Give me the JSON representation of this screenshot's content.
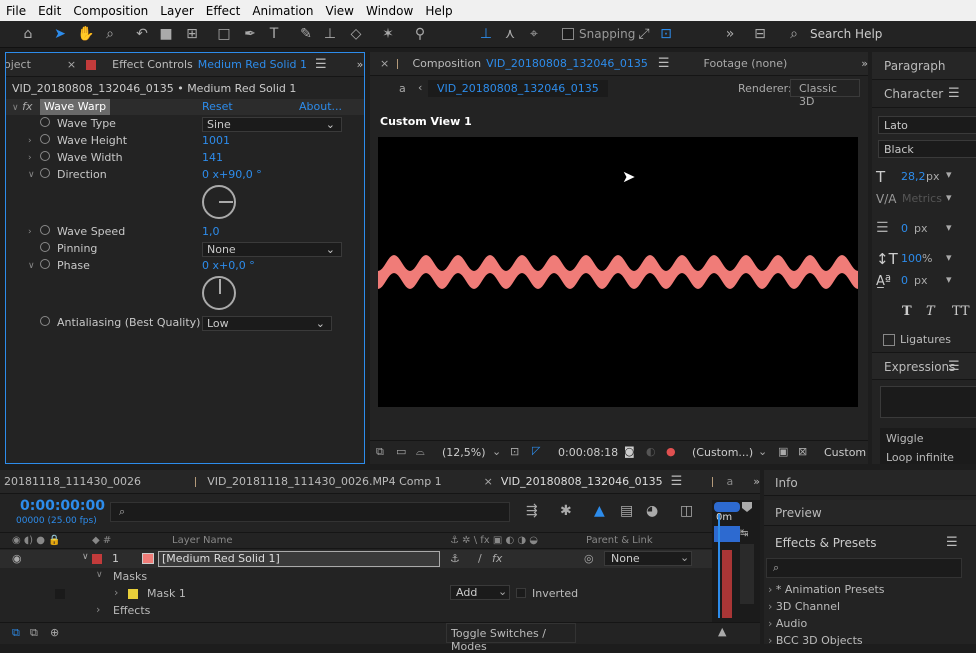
{
  "menu": [
    "File",
    "Edit",
    "Composition",
    "Layer",
    "Effect",
    "Animation",
    "View",
    "Window",
    "Help"
  ],
  "toolbar": {
    "snapping": "Snapping",
    "search": "Search Help"
  },
  "effect_panel": {
    "tab_project": "oject",
    "tab_prefix": "Effect Controls",
    "tab_name": "Medium Red Solid 1",
    "layer_path": "VID_20180808_132046_0135 • Medium Red Solid 1",
    "fx_label": "fx",
    "effect_name": "Wave Warp",
    "reset": "Reset",
    "about": "About...",
    "props": {
      "wave_type": {
        "label": "Wave Type",
        "value": "Sine"
      },
      "wave_height": {
        "label": "Wave Height",
        "value": "1001"
      },
      "wave_width": {
        "label": "Wave Width",
        "value": "141"
      },
      "direction": {
        "label": "Direction",
        "value": "0 x+90,0 °"
      },
      "wave_speed": {
        "label": "Wave Speed",
        "value": "1,0"
      },
      "pinning": {
        "label": "Pinning",
        "value": "None"
      },
      "phase": {
        "label": "Phase",
        "value": "0 x+0,0 °"
      },
      "antialiasing": {
        "label": "Antialiasing (Best Quality)",
        "value": "Low"
      }
    }
  },
  "comp_panel": {
    "tab_prefix": "Composition",
    "tab_name": "VID_20180808_132046_0135",
    "footage": "Footage (none)",
    "crumb_a": "a",
    "crumb": "VID_20180808_132046_0135",
    "renderer_label": "Renderer:",
    "renderer": "Classic 3D",
    "view_label": "Custom View 1",
    "wave_color": "#f07c78",
    "footer": {
      "zoom": "(12,5%)",
      "time": "0:00:08:18",
      "view": "(Custom...)",
      "mode": "Custom"
    }
  },
  "right_panel": {
    "paragraph": "Paragraph",
    "character": "Character",
    "font": "Lato",
    "style": "Black",
    "size": "28,2",
    "size_unit": "px",
    "metrics": "Metrics",
    "leading": "0",
    "leading_unit": "px",
    "scale": "100",
    "scale_unit": "%",
    "baseline": "0",
    "baseline_unit": "px",
    "ligatures": "Ligatures",
    "expressions": "Expressions",
    "wiggle": "Wiggle",
    "loop": "Loop infinite"
  },
  "timeline": {
    "tab1": "20181118_111430_0026",
    "tab2": "VID_20181118_111430_0026.MP4 Comp 1",
    "tab3": "VID_20180808_132046_0135",
    "tab4": "a",
    "timecode": "0:00:00:00",
    "frames": "00000 (25.00 fps)",
    "col_layer": "Layer Name",
    "col_parent": "Parent & Link",
    "layer_num": "1",
    "layer_name": "[Medium Red Solid 1]",
    "parent_value": "None",
    "masks": "Masks",
    "mask1": "Mask 1",
    "mode": "Add",
    "inverted": "Inverted",
    "effects": "Effects",
    "toggle": "Toggle Switches / Modes",
    "ruler": "0m"
  },
  "side": {
    "info": "Info",
    "preview": "Preview",
    "effects_presets": "Effects & Presets",
    "items": [
      "* Animation Presets",
      "3D Channel",
      "Audio",
      "BCC 3D Objects"
    ]
  }
}
